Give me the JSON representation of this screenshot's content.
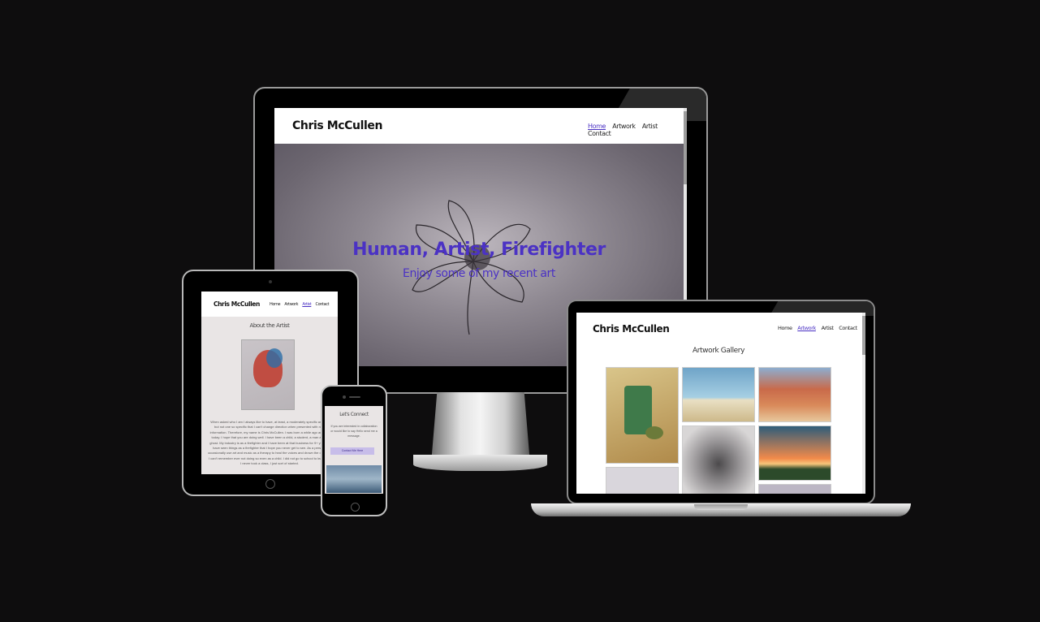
{
  "site": {
    "brand": "Chris McCullen",
    "nav": [
      "Home",
      "Artwork",
      "Artist",
      "Contact"
    ]
  },
  "desktop": {
    "active_nav": "Home",
    "hero_title": "Human, Artist, Firefighter",
    "hero_subtitle": "Enjoy some of my recent art"
  },
  "laptop": {
    "active_nav": "Artwork",
    "heading": "Artwork Gallery"
  },
  "tablet": {
    "active_nav": "Artist",
    "heading": "About the Artist",
    "bio": "When asked who I am I always like to have, at least, a moderately specific answer but not one so specific that I can't change direction when presented with new information. Therefore, my name is Chris McCullen. I was born a while ago and am today. I hope that you are doing well. I have been a child, a student, a man and a ghost. My industry is as a firefighter and I have been at that business for 9+ years. I have seen things as a firefighter that I hope you never get to see. As a person I occasionally use art and music as a therapy to heal the voices and drown the dreams. I can't remember ever not doing so even as a child. I did not go to school to learn art, I never took a class, I just sort of started."
  },
  "phone": {
    "heading": "Let's Connect",
    "text": "If you are interested in collaboration or would like to say Hello send me a message.",
    "button": "Contact Me Here"
  },
  "colors": {
    "accent": "#4b32c4",
    "background": "#0e0d0e"
  }
}
